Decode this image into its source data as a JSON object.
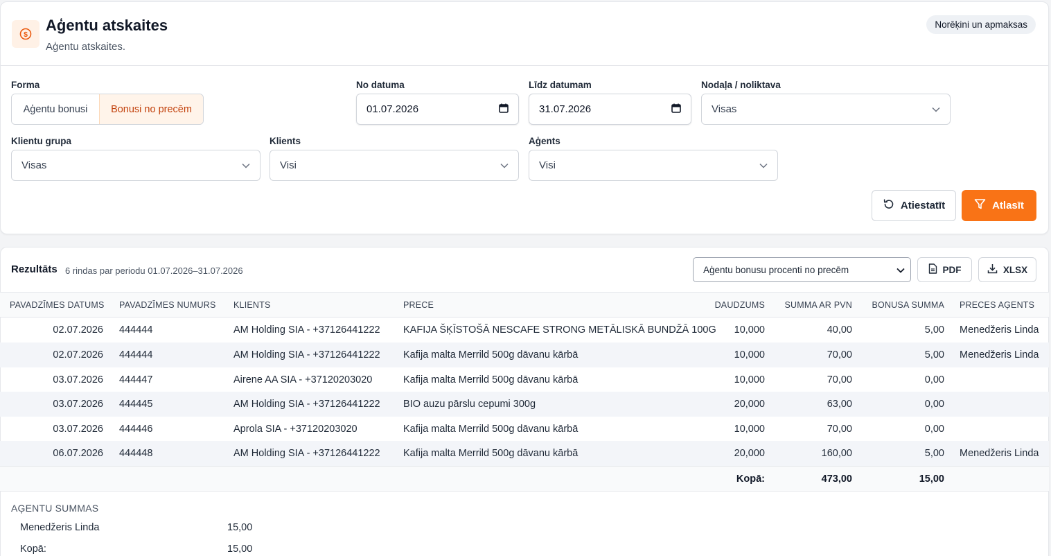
{
  "header": {
    "title": "Aģentu atskaites",
    "subtitle": "Aģentu atskaites.",
    "pill": "Norēķini un apmaksas"
  },
  "filters": {
    "forma_label": "Forma",
    "forma_options": [
      "Aģentu bonusi",
      "Bonusi no precēm"
    ],
    "forma_selected": "Bonusi no precēm",
    "no_datuma_label": "No datuma",
    "no_datuma_value": "01.07.2026",
    "lidz_datumam_label": "Līdz datumam",
    "lidz_datumam_value": "31.07.2026",
    "nodala_label": "Nodaļa / noliktava",
    "nodala_value": "Visas",
    "klientu_grupa_label": "Klientu grupa",
    "klientu_grupa_value": "Visas",
    "klients_label": "Klients",
    "klients_value": "Visi",
    "agents_label": "Aģents",
    "agents_value": "Visi",
    "reset_label": "Atiestatīt",
    "filter_label": "Atlasīt"
  },
  "results": {
    "title": "Rezultāts",
    "meta": "6 rindas par periodu 01.07.2026–31.07.2026",
    "report_select": "Aģentu bonusu procenti no precēm",
    "pdf_label": "PDF",
    "xlsx_label": "XLSX",
    "columns": [
      "PAVADZĪMES DATUMS",
      "PAVADZĪMES NUMURS",
      "KLIENTS",
      "PRECE",
      "DAUDZUMS",
      "SUMMA AR PVN",
      "BONUSA SUMMA",
      "PRECES AĢENTS"
    ],
    "rows": [
      [
        "02.07.2026",
        "444444",
        "AM Holding SIA - +37126441222",
        "KAFIJA ŠĶĪSTOŠĀ NESCAFE STRONG METĀLISKĀ BUNDŽĀ 100G",
        "10,000",
        "40,00",
        "5,00",
        "Menedžeris Linda"
      ],
      [
        "02.07.2026",
        "444444",
        "AM Holding SIA - +37126441222",
        "Kafija malta Merrild 500g dāvanu kārbā",
        "10,000",
        "70,00",
        "5,00",
        "Menedžeris Linda"
      ],
      [
        "03.07.2026",
        "444447",
        "Airene AA SIA - +37120203020",
        "Kafija malta Merrild 500g dāvanu kārbā",
        "10,000",
        "70,00",
        "0,00",
        ""
      ],
      [
        "03.07.2026",
        "444445",
        "AM Holding SIA - +37126441222",
        "BIO auzu pārslu cepumi 300g",
        "20,000",
        "63,00",
        "0,00",
        ""
      ],
      [
        "03.07.2026",
        "444446",
        "Aprola SIA - +37120203020",
        "Kafija malta Merrild 500g dāvanu kārbā",
        "10,000",
        "70,00",
        "0,00",
        ""
      ],
      [
        "06.07.2026",
        "444448",
        "AM Holding SIA - +37126441222",
        "Kafija malta Merrild 500g dāvanu kārbā",
        "20,000",
        "160,00",
        "5,00",
        "Menedžeris Linda"
      ]
    ],
    "total_label": "Kopā:",
    "total_sum": "473,00",
    "total_bonus": "15,00"
  },
  "agent_sums": {
    "title": "AĢENTU SUMMAS",
    "rows": [
      {
        "name": "Menedžeris Linda",
        "value": "15,00"
      },
      {
        "name": "Kopā:",
        "value": "15,00"
      }
    ]
  },
  "icons": {
    "header": "dollar-coin-icon",
    "calendar": "calendar-icon",
    "chevron": "chevron-down-icon",
    "reset": "rotate-ccw-icon",
    "filter": "funnel-icon",
    "pdf": "file-icon",
    "xlsx": "download-icon"
  },
  "colors": {
    "accent": "#f97316",
    "accent_soft": "#fff4ea",
    "stripe": "#f3f5f9"
  }
}
